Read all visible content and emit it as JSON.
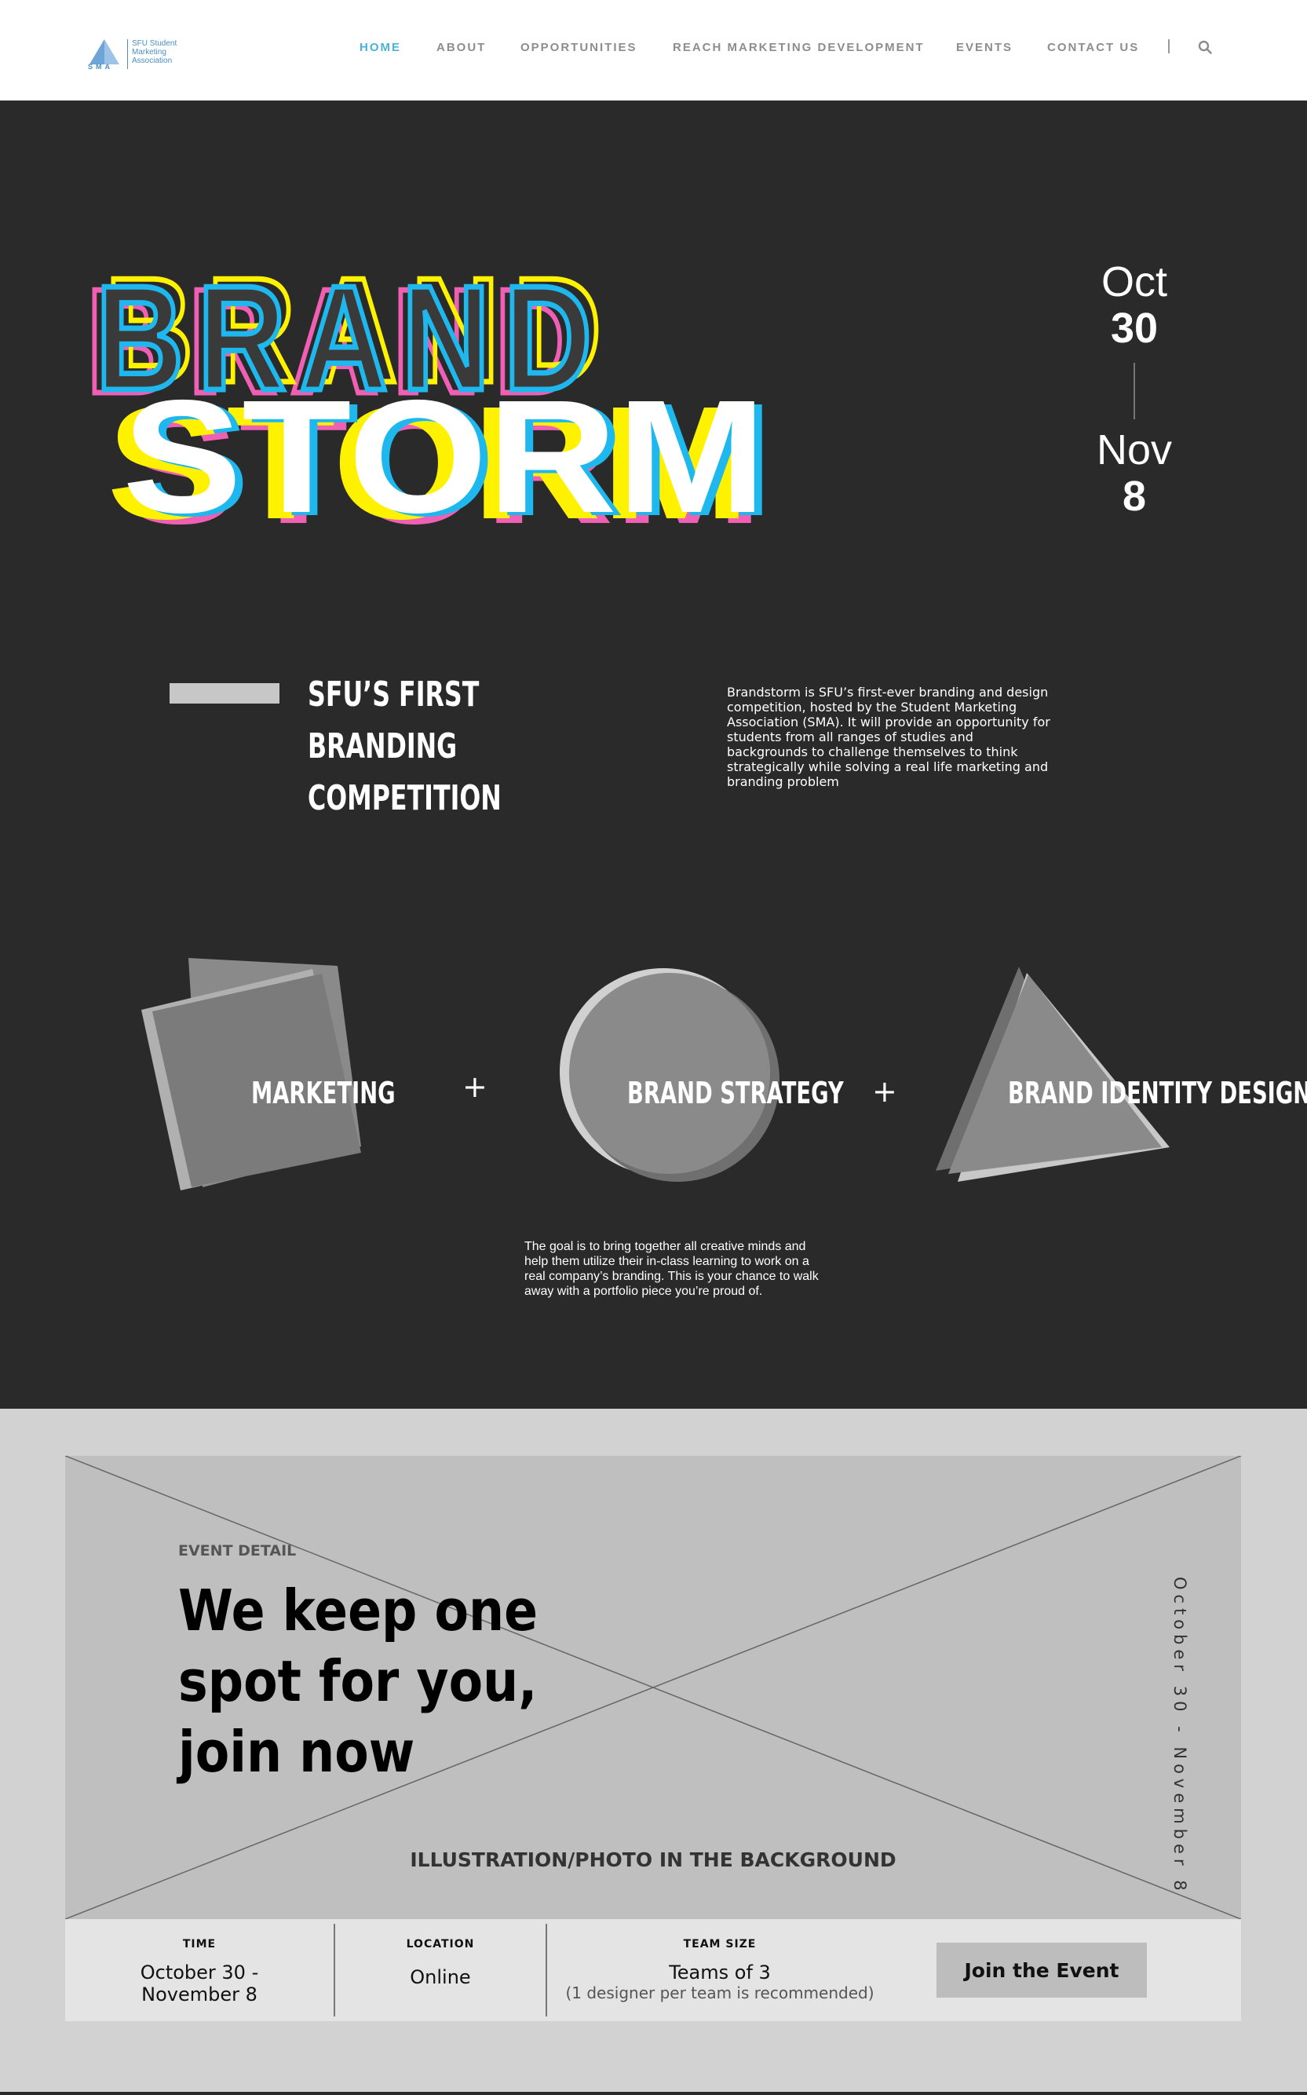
{
  "header": {
    "logo_lines": [
      "SFU Student",
      "Marketing",
      "Association"
    ],
    "logo_abbr": "SMA",
    "nav": [
      {
        "label": "HOME",
        "active": true
      },
      {
        "label": "ABOUT",
        "active": false
      },
      {
        "label": "OPPORTUNITIES",
        "active": false
      },
      {
        "label": "REACH MARKETING DEVELOPMENT",
        "active": false
      },
      {
        "label": "EVENTS",
        "active": false
      },
      {
        "label": "CONTACT US",
        "active": false
      }
    ],
    "search_icon": "search-icon"
  },
  "hero": {
    "title_line1": "BRAND",
    "title_line2": "STORM",
    "start_month": "Oct",
    "start_day": "30",
    "end_month": "Nov",
    "end_day": "8",
    "first_heading": "SFU’S FIRST BRANDING COMPETITION",
    "intro": "Brandstorm is SFU’s first-ever branding and design competition, hosted by the Student Marketing Association (SMA). It will provide an opportunity for students from all ranges of studies and backgrounds to challenge themselves to think strategically while solving a real life marketing and branding problem",
    "shapes": [
      "MARKETING",
      "BRAND STRATEGY",
      "BRAND IDENTITY DESIGN"
    ],
    "plus": "+",
    "goal": "The goal is to bring together all creative minds and help them utilize their in-class learning to work on a real company’s branding. This is your chance to walk away with a portfolio piece you’re proud of."
  },
  "event": {
    "kicker": "EVENT DETAIL",
    "heading": "We keep one spot for you, join now",
    "vertical_date": "October 30 - November 8",
    "illustration_caption": "ILLUSTRATION/PHOTO IN THE BACKGROUND",
    "time_label": "TIME",
    "time_value": "October 30 - November 8",
    "location_label": "LOCATION",
    "location_value": "Online",
    "team_label": "TEAM SIZE",
    "team_value": "Teams of 3",
    "team_note": "(1 designer per team is recommended)",
    "join_button": "Join the Event"
  },
  "colors": {
    "accent_blue": "#4ab2d8",
    "cyan": "#1fb8ee",
    "magenta": "#ef5fb3",
    "yellow": "#fff200",
    "dark_bg": "#2a2a2a"
  }
}
